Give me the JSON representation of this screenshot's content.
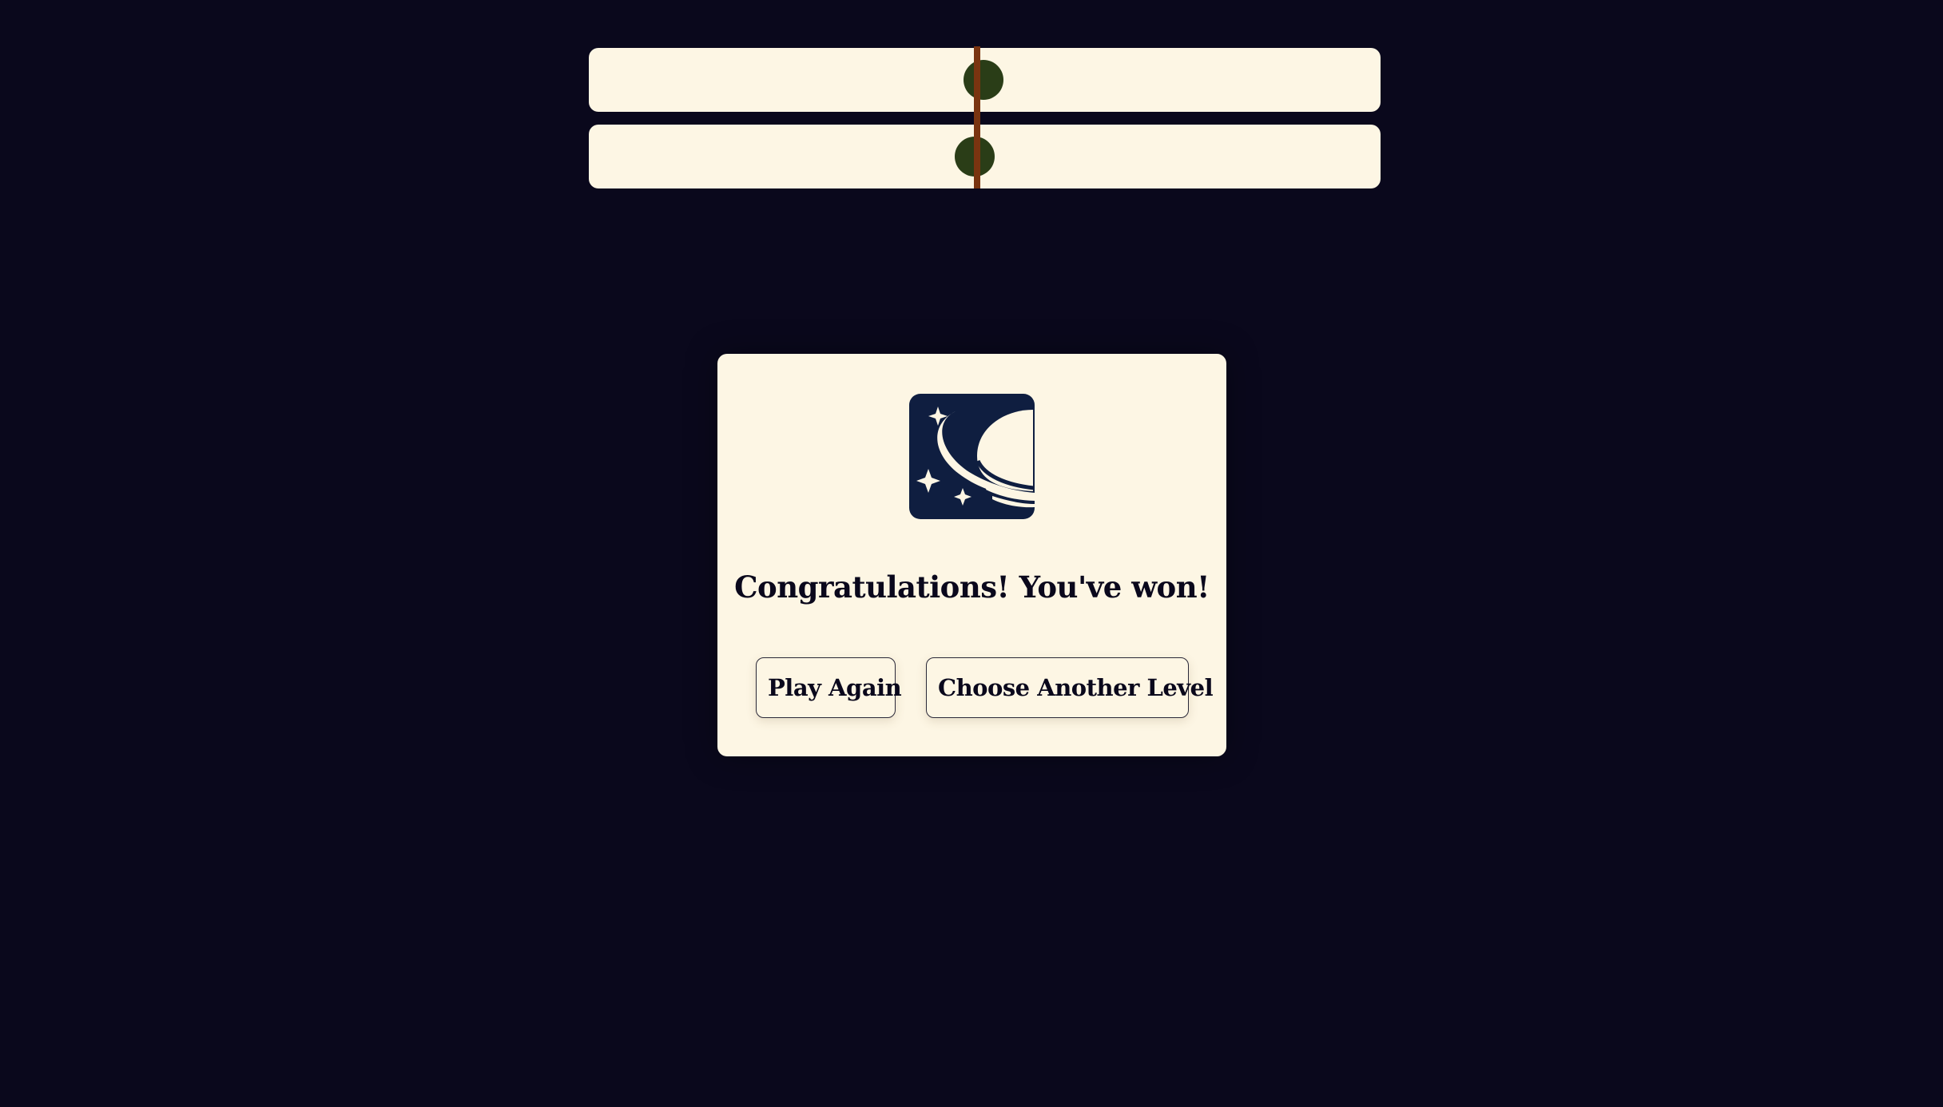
{
  "game": {
    "tracks": [
      {
        "id": "track-1",
        "marker_position": 0.498
      },
      {
        "id": "track-2",
        "marker_position": 0.487
      }
    ],
    "target_position": 0.49,
    "colors": {
      "background": "#0a081c",
      "track": "#fdf6e4",
      "marker": "#2a3d17",
      "target_line": "#7a3410"
    }
  },
  "dialog": {
    "logo_icon": "saturn-planet-icon",
    "title": "Congratulations! You've won!",
    "play_again_label": "Play Again",
    "choose_level_label": "Choose Another Level",
    "colors": {
      "panel": "#fdf6e4",
      "logo_background": "#0f1e40",
      "text": "#0a081c"
    }
  }
}
